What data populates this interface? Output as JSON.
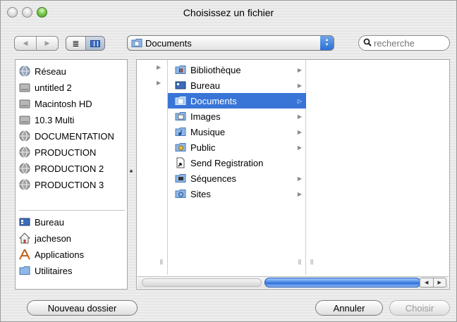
{
  "window": {
    "title": "Choisissez un fichier"
  },
  "toolbar": {
    "back": "◀",
    "forward": "▶",
    "view_list": "≣",
    "path_popup": {
      "label": "Documents",
      "icon": "documents-folder-icon"
    },
    "search": {
      "placeholder": "recherche",
      "icon": "search-icon"
    }
  },
  "sidebar": {
    "devices": [
      {
        "label": "Réseau",
        "icon": "network-icon"
      },
      {
        "label": "untitled 2",
        "icon": "drive-icon"
      },
      {
        "label": "Macintosh HD",
        "icon": "drive-icon"
      },
      {
        "label": "10.3 Multi",
        "icon": "drive-icon"
      },
      {
        "label": "DOCUMENTATION",
        "icon": "network-volume-icon"
      },
      {
        "label": "PRODUCTION",
        "icon": "network-volume-icon"
      },
      {
        "label": "PRODUCTION 2",
        "icon": "network-volume-icon"
      },
      {
        "label": "PRODUCTION 3",
        "icon": "network-volume-icon"
      }
    ],
    "places": [
      {
        "label": "Bureau",
        "icon": "desktop-icon"
      },
      {
        "label": "jacheson",
        "icon": "home-icon"
      },
      {
        "label": "Applications",
        "icon": "applications-icon"
      },
      {
        "label": "Utilitaires",
        "icon": "folder-icon"
      }
    ]
  },
  "browser": {
    "column1_arrows": [
      "▶",
      "▶"
    ],
    "column2": [
      {
        "label": "Bibliothèque",
        "icon": "library-folder-icon",
        "has_children": true,
        "selected": false
      },
      {
        "label": "Bureau",
        "icon": "desktop-icon",
        "has_children": true,
        "selected": false
      },
      {
        "label": "Documents",
        "icon": "documents-folder-icon",
        "has_children": true,
        "selected": true
      },
      {
        "label": "Images",
        "icon": "pictures-folder-icon",
        "has_children": true,
        "selected": false
      },
      {
        "label": "Musique",
        "icon": "music-folder-icon",
        "has_children": true,
        "selected": false
      },
      {
        "label": "Public",
        "icon": "public-folder-icon",
        "has_children": true,
        "selected": false
      },
      {
        "label": "Send Registration",
        "icon": "alias-file-icon",
        "has_children": false,
        "selected": false
      },
      {
        "label": "Séquences",
        "icon": "movies-folder-icon",
        "has_children": true,
        "selected": false
      },
      {
        "label": "Sites",
        "icon": "sites-folder-icon",
        "has_children": true,
        "selected": false
      }
    ],
    "column3": []
  },
  "buttons": {
    "new_folder": "Nouveau dossier",
    "cancel": "Annuler",
    "choose": "Choisir"
  },
  "colors": {
    "selection": "#3875d7",
    "scroll_thumb": "#2f6fd2",
    "zoom_light": "#5fba3a"
  }
}
